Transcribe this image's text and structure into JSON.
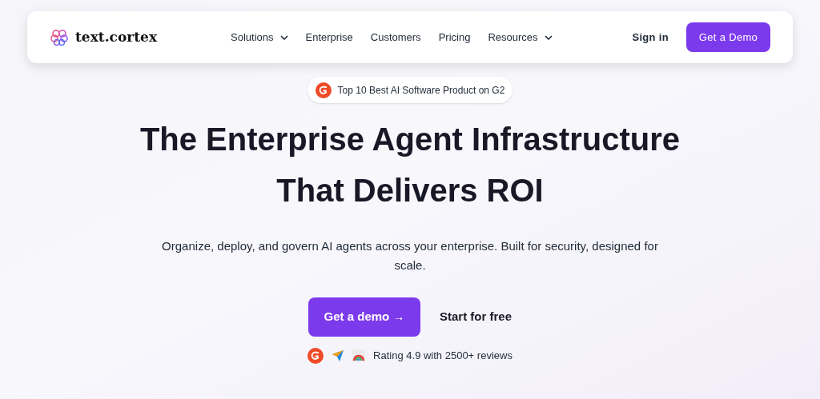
{
  "nav": {
    "brand": "text.cortex",
    "items": [
      {
        "label": "Solutions",
        "has_menu": true
      },
      {
        "label": "Enterprise",
        "has_menu": false
      },
      {
        "label": "Customers",
        "has_menu": false
      },
      {
        "label": "Pricing",
        "has_menu": false
      },
      {
        "label": "Resources",
        "has_menu": true
      }
    ],
    "sign_in": "Sign in",
    "cta": "Get a Demo"
  },
  "badge": "Top 10 Best AI Software Product on G2",
  "headline": [
    "The Enterprise Agent Infrastructure",
    "That Delivers ROI"
  ],
  "subtitle": "Organize, deploy, and govern AI agents across your enterprise. Built for security, designed for scale.",
  "primary_button": "Get a demo →",
  "secondary_button": "Start for free",
  "rating": "Rating 4.9 with 2500+ reviews"
}
